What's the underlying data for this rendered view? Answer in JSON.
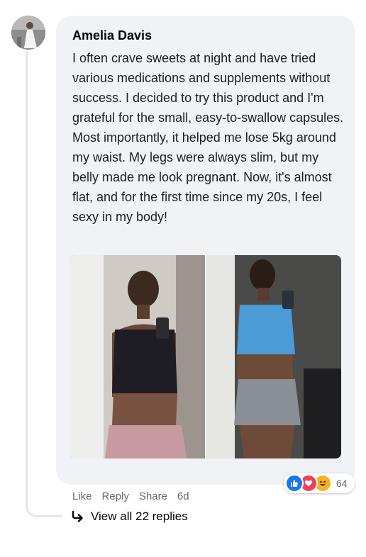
{
  "comment": {
    "author": "Amelia Davis",
    "text": "I often crave sweets at night and have tried various medications and supplements without success. I decided to try this product and I'm grateful for the small, easy-to-swallow capsules. Most importantly, it helped me lose 5kg around my waist. My legs were always slim, but my belly made me look pregnant. Now, it's almost flat, and for the first time since my 20s, I feel sexy in my body!"
  },
  "reactions": {
    "icons": [
      "like-icon",
      "love-icon",
      "haha-icon"
    ],
    "count": "64"
  },
  "actions": {
    "like": "Like",
    "reply": "Reply",
    "share": "Share",
    "time": "6d"
  },
  "replies": {
    "label": "View all 22 replies"
  },
  "colors": {
    "bubble": "#f0f2f5",
    "secondary_text": "#65676b",
    "like_blue": "#1877f2",
    "love_red": "#f33e58",
    "haha_yellow": "#f7b125"
  }
}
